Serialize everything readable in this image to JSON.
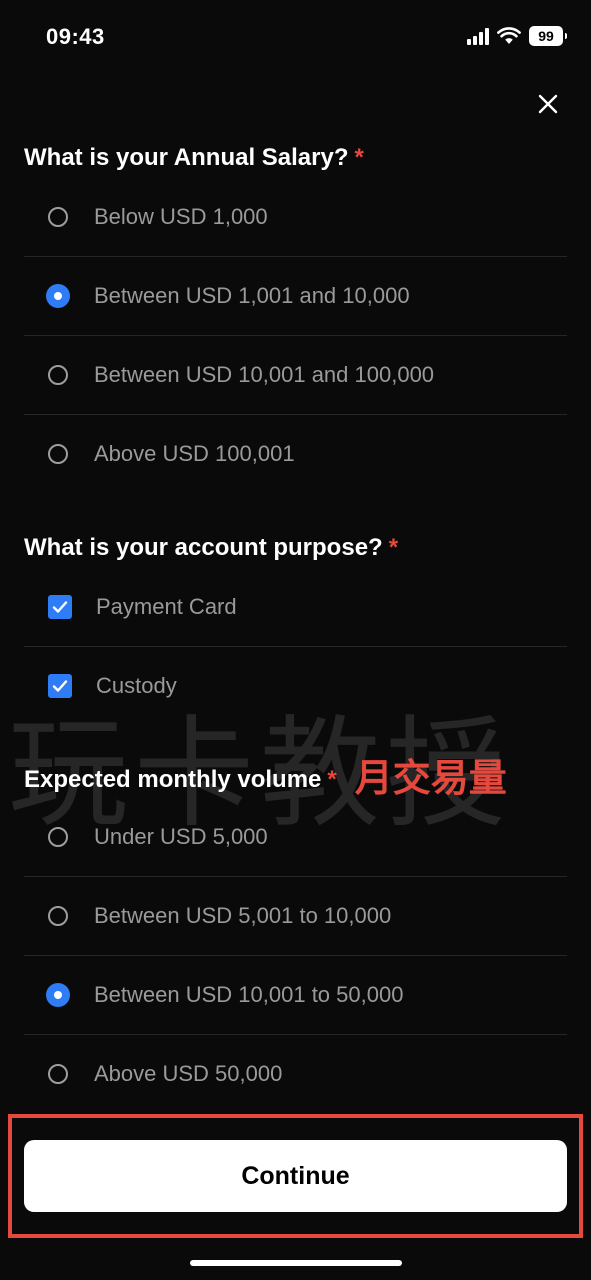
{
  "status_bar": {
    "time": "09:43",
    "battery": "99"
  },
  "sections": [
    {
      "title": "What is your Annual Salary?",
      "required_mark": "*",
      "options": [
        {
          "label": "Below USD 1,000",
          "selected": false
        },
        {
          "label": "Between USD 1,001 and 10,000",
          "selected": true
        },
        {
          "label": "Between USD 10,001 and 100,000",
          "selected": false
        },
        {
          "label": "Above USD 100,001",
          "selected": false
        }
      ]
    },
    {
      "title": "What is your account purpose?",
      "required_mark": "*",
      "options": [
        {
          "label": "Payment Card",
          "checked": true
        },
        {
          "label": "Custody",
          "checked": true
        }
      ]
    },
    {
      "title": "Expected monthly volume",
      "required_mark": "*",
      "annotation": "月交易量",
      "options": [
        {
          "label": "Under USD 5,000",
          "selected": false
        },
        {
          "label": "Between USD 5,001 to 10,000",
          "selected": false
        },
        {
          "label": "Between USD 10,001 to 50,000",
          "selected": true
        },
        {
          "label": "Above USD 50,000",
          "selected": false
        }
      ]
    }
  ],
  "watermark": "玩卡教授",
  "continue_label": "Continue",
  "colors": {
    "accent": "#2f7df6",
    "required": "#e5483c",
    "background": "#0a0a0a",
    "muted_text": "#9a9a9a"
  }
}
